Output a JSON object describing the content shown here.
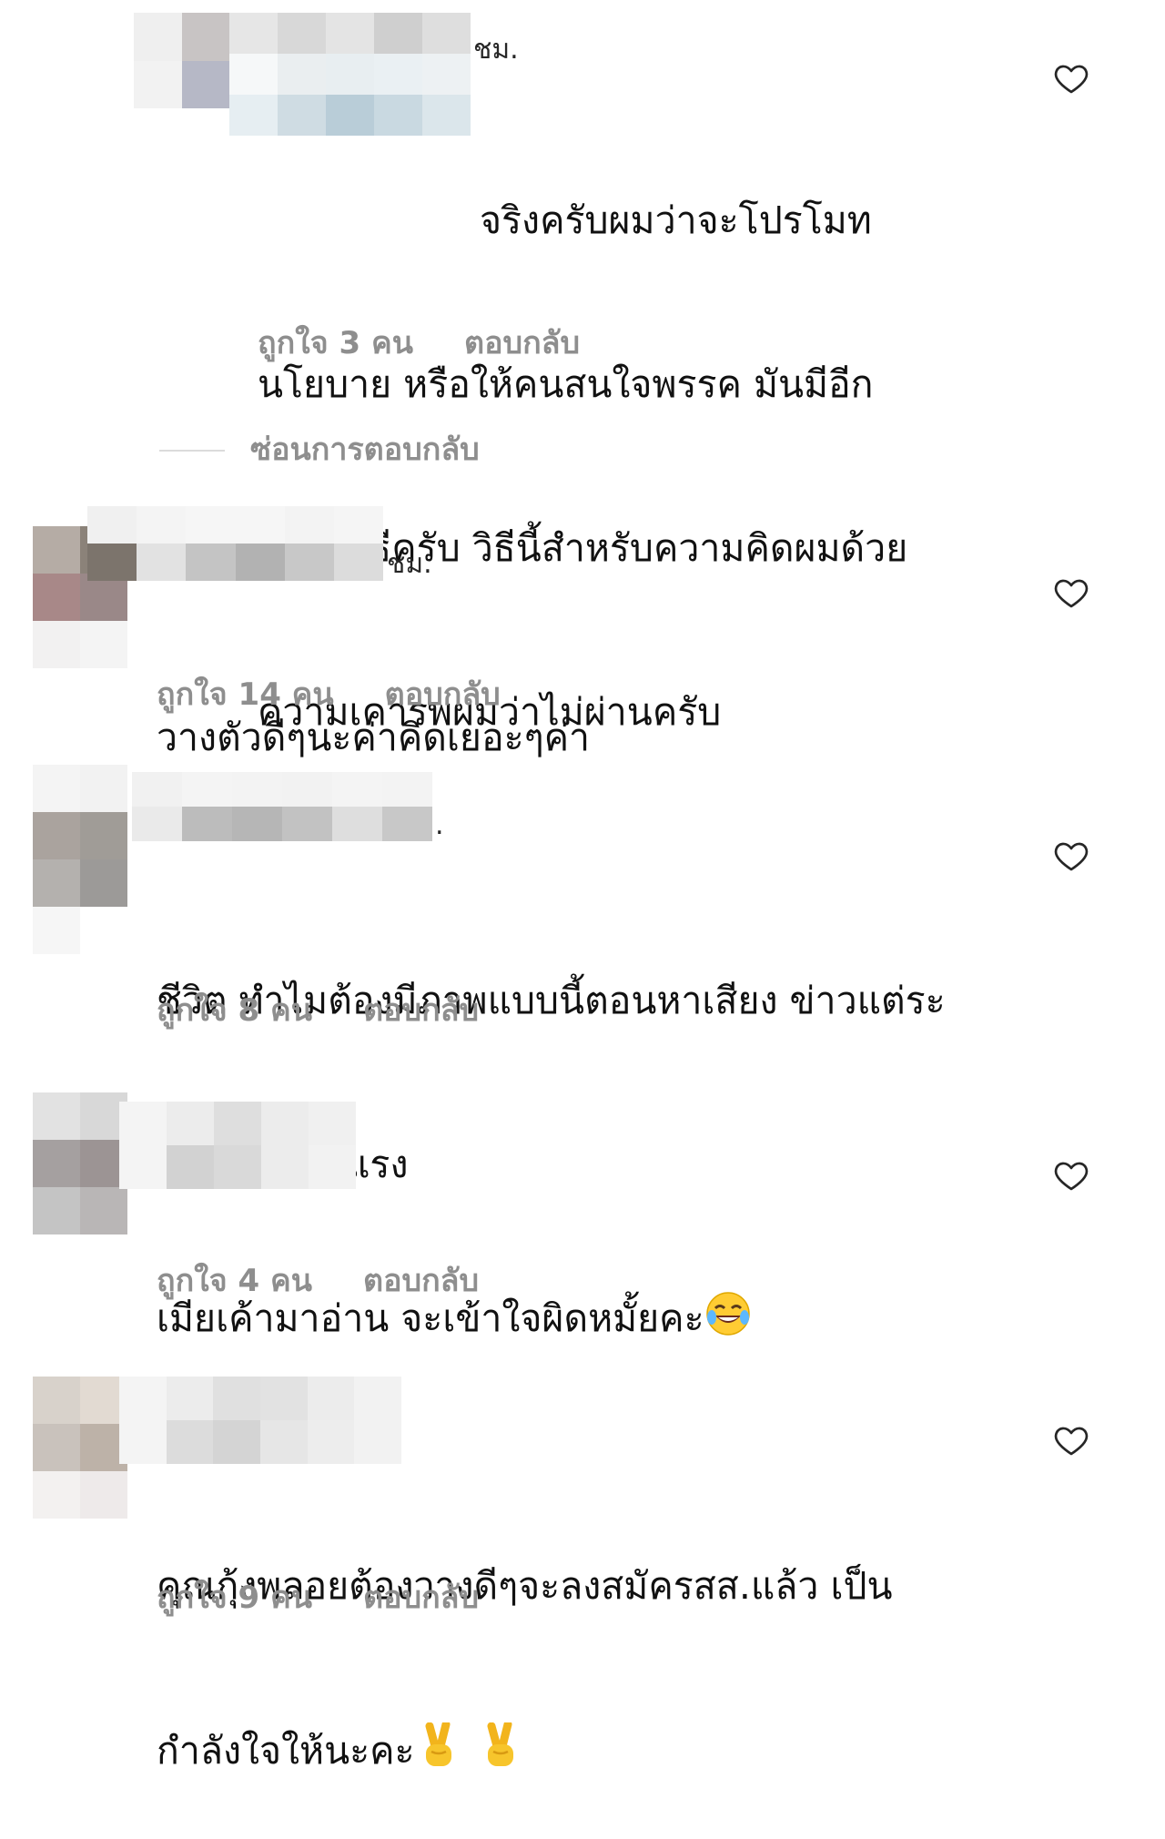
{
  "comments": [
    {
      "username_suffix": "ชม.",
      "text_lines": [
        "จริงครับผมว่าจะโปรโมท",
        "นโยบาย หรือให้คนสนใจพรรค มันมีอีก",
        "หลายวิธีครับ วิธีนี้สำหรับความคิดผมด้วย",
        "ความเคารพผมว่าไม่ผ่านครับ"
      ],
      "likes": "ถูกใจ 3 คน",
      "reply": "ตอบกลับ"
    },
    {
      "username_suffix": "ชม.",
      "text_lines": [
        "วางตัวดีๆนะค่าคิดเยอะๆค่า"
      ],
      "likes": "ถูกใจ 14 คน",
      "reply": "ตอบกลับ"
    },
    {
      "username_suffix": ".",
      "text_lines": [
        "ชีวิต ทำไมต้องมีภาพแบบนี้ตอนหาเสียง ข่าวแต่ระ",
        "อย่างเปิดตัวแรง"
      ],
      "likes": "ถูกใจ 8 คน",
      "reply": "ตอบกลับ"
    },
    {
      "username_suffix": "",
      "text_lines": [
        "เมียเค้ามาอ่าน จะเข้าใจผิดหมั้ยคะ"
      ],
      "emoji": [
        "face-with-tears-of-joy"
      ],
      "likes": "ถูกใจ 4 คน",
      "reply": "ตอบกลับ"
    },
    {
      "username_suffix": "",
      "text_lines": [
        "คุณกุ้งพลอยต้องวางดีๆจะลงสมัครสส.แล้ว เป็น",
        "กำลังใจให้นะคะ"
      ],
      "emoji": [
        "victory-hand",
        "victory-hand"
      ],
      "likes": "ถูกใจ 9 คน",
      "reply": "ตอบกลับ"
    }
  ],
  "hide_replies": "ซ่อนการตอบกลับ",
  "colors": {
    "meta_gray": "#8e8e8e",
    "text": "#111111",
    "divider": "#dbdbdb"
  }
}
